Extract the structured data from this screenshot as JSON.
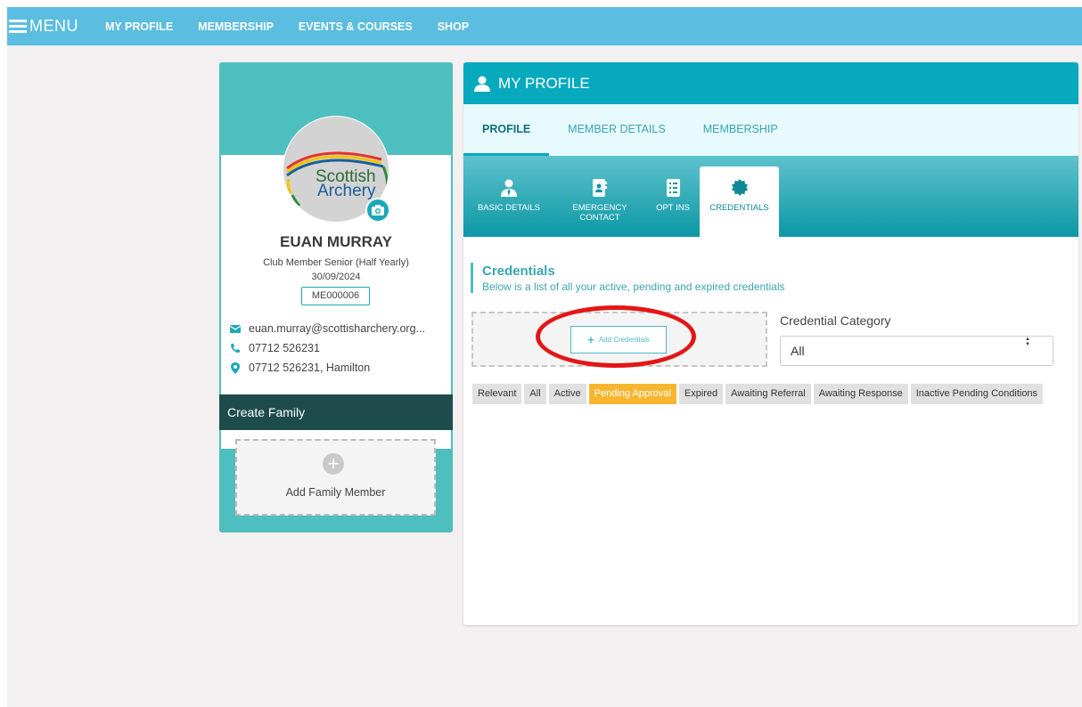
{
  "nav": {
    "menu_label": "MENU",
    "links": [
      "MY PROFILE",
      "MEMBERSHIP",
      "EVENTS & COURSES",
      "SHOP"
    ]
  },
  "profile": {
    "logo_text_line1": "Scottish",
    "logo_text_line2": "Archery",
    "name": "EUAN MURRAY",
    "membership_type": "Club Member Senior (Half Yearly)",
    "membership_date": "30/09/2024",
    "member_id": "ME000006",
    "email": "euan.murray@scottisharchery.org...",
    "phone": "07712 526231",
    "address": "07712 526231, Hamilton"
  },
  "family": {
    "header": "Create Family",
    "add_label": "Add Family Member"
  },
  "main": {
    "header_title": "MY PROFILE",
    "tabs": [
      "PROFILE",
      "MEMBER DETAILS",
      "MEMBERSHIP"
    ],
    "active_tab": "PROFILE",
    "sub_tabs": [
      {
        "label": "BASIC DETAILS",
        "icon": "user-tie-icon"
      },
      {
        "label": "EMERGENCY CONTACT",
        "icon": "contact-book-icon"
      },
      {
        "label": "OPT INS",
        "icon": "checklist-icon"
      },
      {
        "label": "CREDENTIALS",
        "icon": "badge-certificate-icon"
      }
    ],
    "active_sub_tab": "CREDENTIALS"
  },
  "credentials": {
    "title": "Credentials",
    "subtitle": "Below is a list of all your active, pending and expired credentials",
    "add_button": "Add Credentials",
    "category_label": "Credential Category",
    "category_value": "All",
    "filters": [
      "Relevant",
      "All",
      "Active",
      "Pending Approval",
      "Expired",
      "Awaiting Referral",
      "Awaiting Response",
      "Inactive Pending Conditions"
    ],
    "active_filter": "Pending Approval"
  },
  "colors": {
    "nav_bg": "#5bbde0",
    "teal": "#07a9bd",
    "card_teal": "#4dbfbe",
    "family_header": "#1e4c4d",
    "pending": "#f8b630",
    "annotation_red": "#e31616"
  }
}
